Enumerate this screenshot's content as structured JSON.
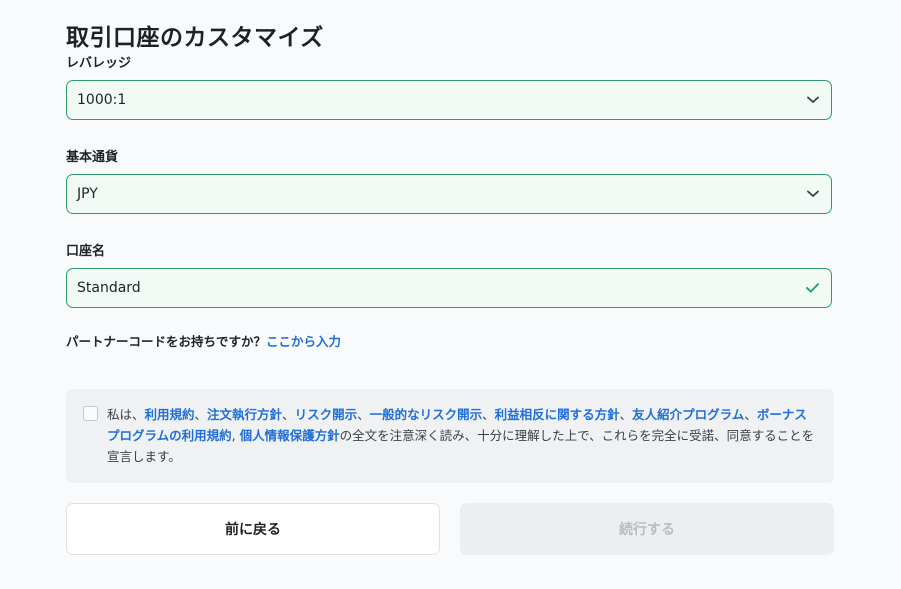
{
  "page": {
    "title": "取引口座のカスタマイズ"
  },
  "leverage": {
    "label": "レバレッジ",
    "value": "1000:1"
  },
  "currency": {
    "label": "基本通貨",
    "value": "JPY"
  },
  "account_name": {
    "label": "口座名",
    "value": "Standard"
  },
  "partner": {
    "text": "パートナーコードをお持ちですか？",
    "link": "ここから入力"
  },
  "agreement": {
    "prefix": "私は、",
    "link_terms": "利用規約",
    "sep1": "、",
    "link_execution": "注文執行方針",
    "sep2": "、",
    "link_risk": "リスク開示",
    "sep3": "、",
    "link_general_risk": "一般的なリスク開示",
    "sep4": "、",
    "link_conflict": "利益相反に関する方針",
    "sep5": "、",
    "link_referral": "友人紹介プログラム",
    "sep6": "、",
    "link_bonus": "ボーナスプログラムの利用規約",
    "sep7": ", ",
    "link_privacy": "個人情報保護方針",
    "suffix": "の全文を注意深く読み、十分に理解した上で、これらを完全に受諾、同意することを宣言します。"
  },
  "buttons": {
    "back": "前に戻る",
    "continue": "続行する"
  },
  "colors": {
    "accent": "#2e9b6d",
    "link": "#1f6fd6",
    "field_bg": "#f2faf6"
  }
}
